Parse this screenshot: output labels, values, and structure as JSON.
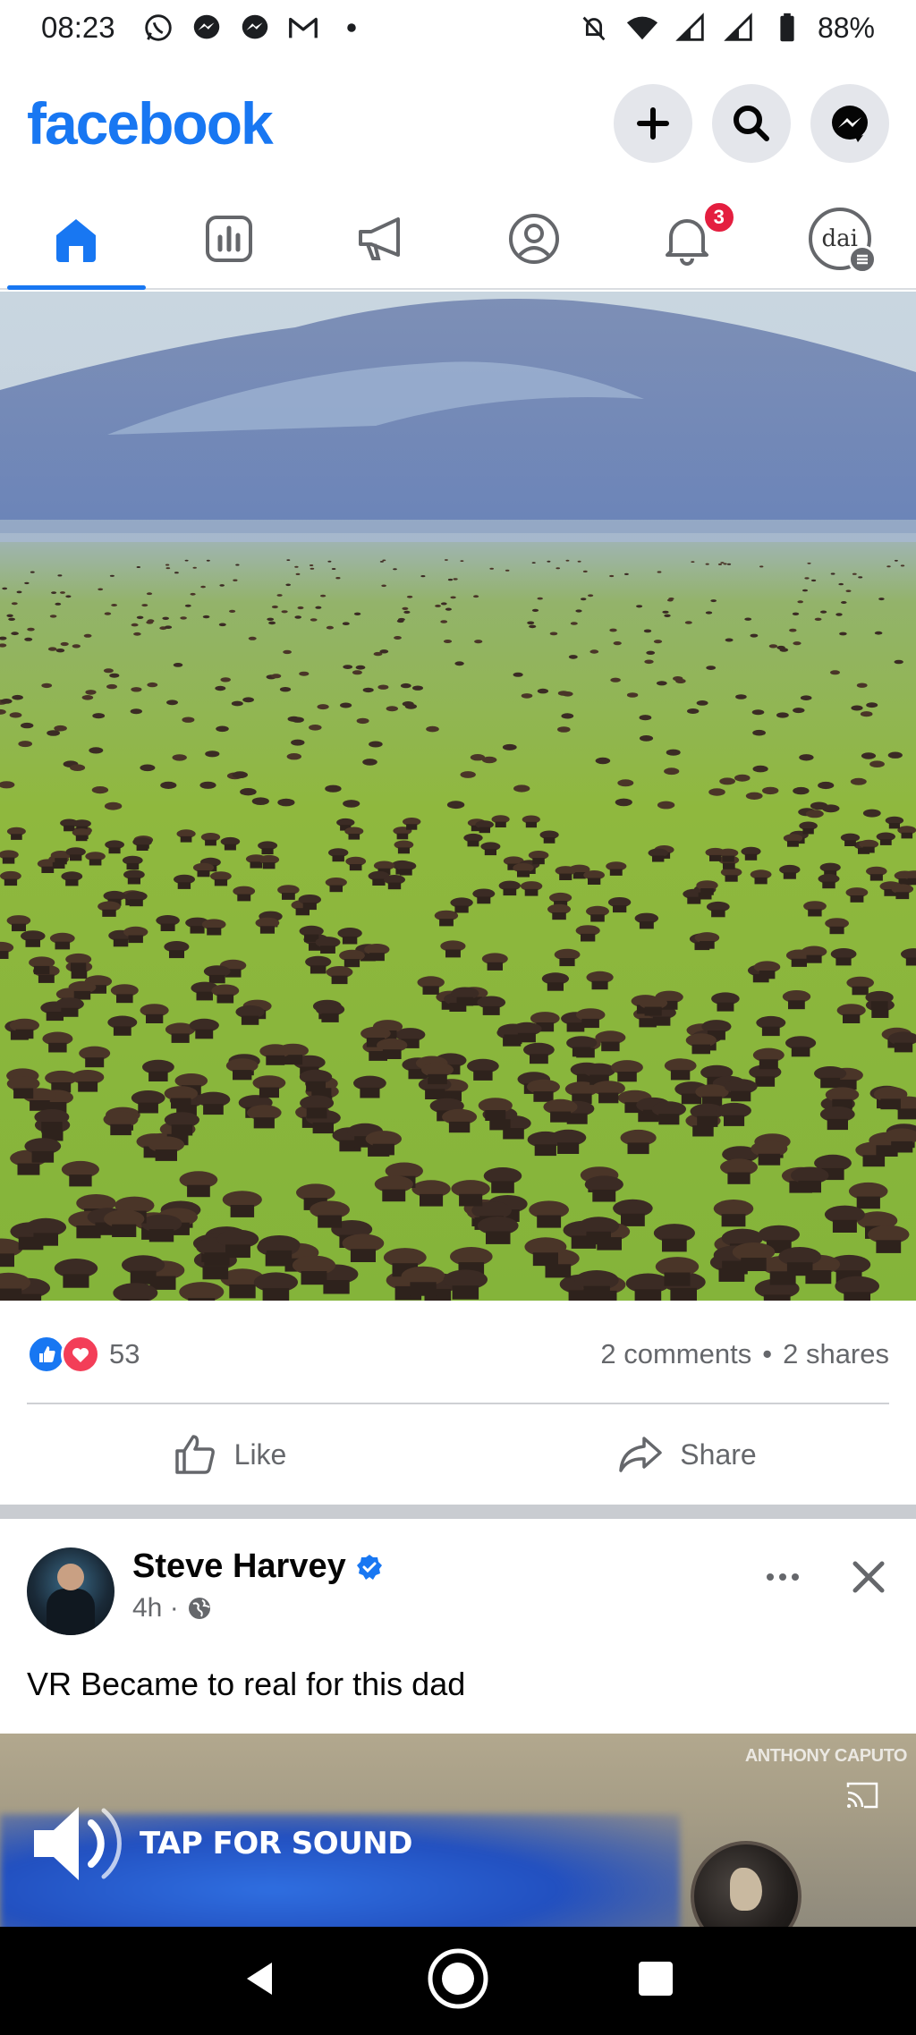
{
  "status_bar": {
    "time": "08:23",
    "notification_icons": [
      "whatsapp-icon",
      "messenger-icon",
      "messenger-icon",
      "gmail-icon",
      "dot-icon"
    ],
    "system_icons": [
      "mute-icon",
      "wifi-icon",
      "signal-icon",
      "signal-icon",
      "battery-icon"
    ],
    "battery": "88%"
  },
  "header": {
    "logo": "facebook",
    "actions": [
      "create-icon",
      "search-icon",
      "messenger-icon"
    ]
  },
  "tabs": [
    {
      "name": "home",
      "icon": "home-icon",
      "active": true
    },
    {
      "name": "dashboard",
      "icon": "chart-icon",
      "active": false
    },
    {
      "name": "ads",
      "icon": "megaphone-icon",
      "active": false
    },
    {
      "name": "profile",
      "icon": "profile-icon",
      "active": false
    },
    {
      "name": "notifications",
      "icon": "bell-icon",
      "active": false,
      "badge": "3"
    },
    {
      "name": "menu",
      "icon": "avatar-icon",
      "active": false,
      "avatar_text": "dai"
    }
  ],
  "post1": {
    "reaction_count": "53",
    "comments": "2 comments",
    "separator": "•",
    "shares": "2 shares",
    "like_label": "Like",
    "share_label": "Share"
  },
  "post2": {
    "author": "Steve Harvey",
    "time": "4h ·",
    "text": "VR Became to real for this dad",
    "video": {
      "watermark": "ANTHONY CAPUTO",
      "tap_label": "TAP FOR SOUND"
    }
  },
  "colors": {
    "brand": "#1877f2",
    "badge": "#e41e3f",
    "love": "#f33e58",
    "secondary_text": "#65676b"
  }
}
